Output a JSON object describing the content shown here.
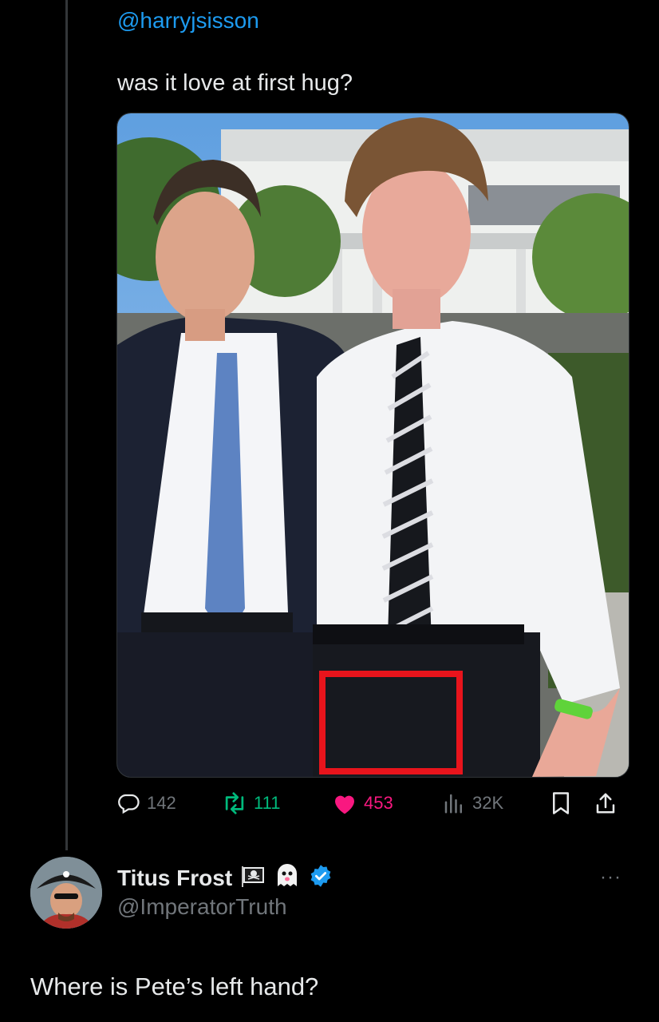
{
  "tweet": {
    "mention": "@harryjsisson",
    "text": "was it love at first hug?",
    "image_alt": "Photo of two men in white shirts and ties in front of a white building, with a red box highlighted",
    "stats": {
      "replies": "142",
      "retweets": "111",
      "likes": "453",
      "views": "32K"
    },
    "colors": {
      "mention": "#1d9bf0",
      "retweet": "#00ba7c",
      "like": "#f91880",
      "muted": "#71767b",
      "highlight_box": "#e8141c"
    }
  },
  "reply": {
    "display_name": "Titus Frost",
    "emojis": [
      "pirate-flag-icon",
      "ghost-icon"
    ],
    "verified": true,
    "handle": "@ImperatorTruth",
    "text": "Where is Pete’s left hand?",
    "more": "···"
  }
}
